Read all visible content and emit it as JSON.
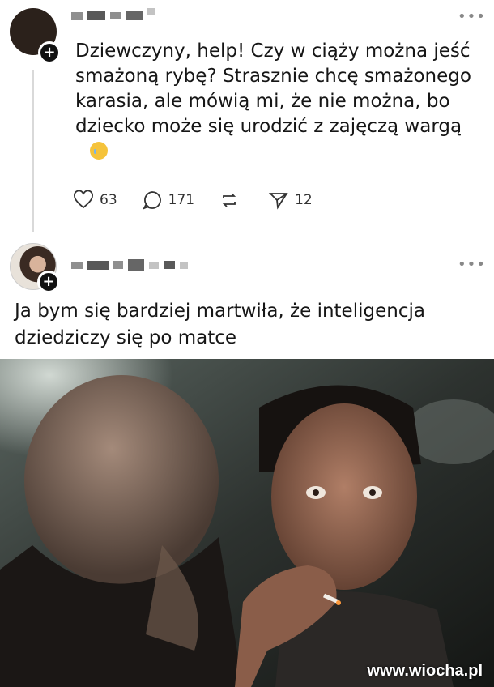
{
  "post": {
    "text": "Dziewczyny, help! Czy w ciąży można jeść smażoną rybę? Strasznie chcę smażonego karasia, ale mówią mi, że nie można, bo dziecko może się urodzić z zajęczą wargą",
    "emoji": "crying-face-emoji",
    "actions": {
      "likes": "63",
      "comments": "171",
      "shares": "12"
    }
  },
  "reply": {
    "text": "Ja bym się bardziej martwiła, że inteligencja dziedziczy się po matce"
  },
  "image": {
    "icon": "reaction-photo",
    "watermark": "www.wiocha.pl"
  },
  "colors": {
    "background": "#ffffff",
    "text": "#161616",
    "badge": "#111111"
  }
}
